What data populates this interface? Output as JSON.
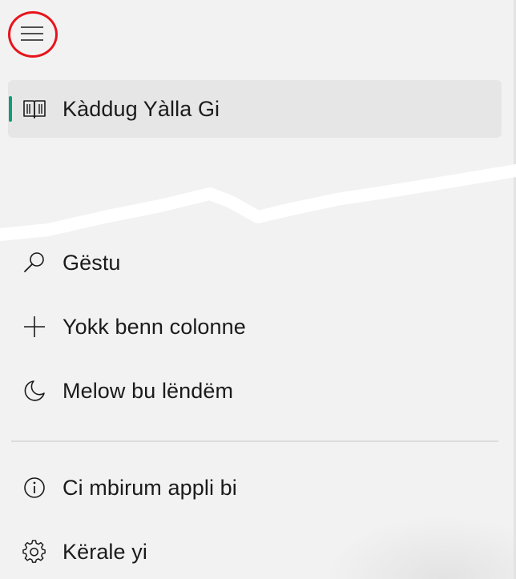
{
  "menu": {
    "toggle_name": "hamburger-menu"
  },
  "nav": {
    "primary": [
      {
        "label": "Kàddug Yàlla Gi",
        "icon": "book-icon",
        "selected": true
      }
    ],
    "actions": [
      {
        "label": "Gëstu",
        "icon": "search-icon"
      },
      {
        "label": "Yokk benn colonne",
        "icon": "plus-icon"
      },
      {
        "label": "Melow bu lëndëm",
        "icon": "moon-icon"
      }
    ],
    "footer": [
      {
        "label": "Ci mbirum appli bi",
        "icon": "info-icon"
      },
      {
        "label": "Kërale yi",
        "icon": "gear-icon"
      }
    ]
  },
  "colors": {
    "background": "#f2f2f2",
    "selected_background": "#e6e6e6",
    "accent": "#0f9d7a",
    "highlight_circle": "#e8141c"
  }
}
